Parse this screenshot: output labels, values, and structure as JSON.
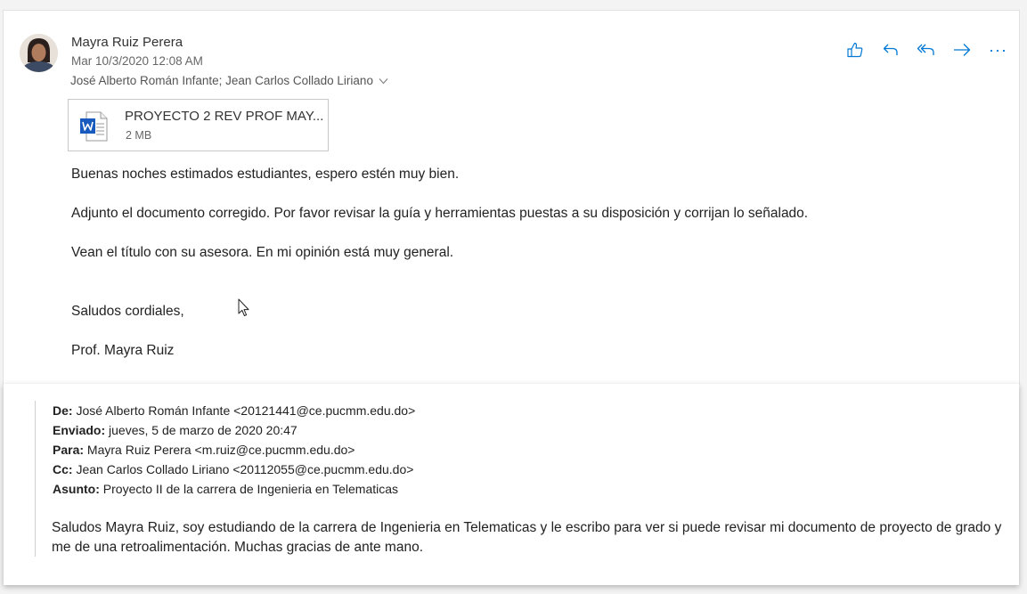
{
  "message": {
    "sender": "Mayra Ruiz Perera",
    "date": "Mar 10/3/2020 12:08 AM",
    "recipients": "José Alberto Román Infante; Jean Carlos Collado Liriano",
    "icons": {
      "avatar": "sender-avatar",
      "expand": "chevron-down-icon",
      "like": "like-icon",
      "reply": "reply-icon",
      "reply_all": "reply-all-icon",
      "forward": "forward-icon",
      "more": "more-icon"
    },
    "accent_color": "#0078d4",
    "attachment": {
      "name": "PROYECTO 2 REV PROF MAY...",
      "size": "2 MB",
      "icon": "word-doc-icon"
    },
    "body": {
      "line1": "Buenas noches estimados estudiantes, espero estén muy bien.",
      "line2": "Adjunto el documento corregido. Por favor revisar la guía y herramientas puestas a su disposición y corrijan lo señalado.",
      "line3": "Vean el título con su asesora. En mi opinión está muy general.",
      "closing": "Saludos cordiales,",
      "signature": "Prof. Mayra Ruiz"
    }
  },
  "quoted": {
    "from_label": "De:",
    "from": "José Alberto Román Infante <20121441@ce.pucmm.edu.do>",
    "sent_label": "Enviado:",
    "sent": "jueves, 5 de marzo de 2020 20:47",
    "to_label": "Para:",
    "to": "Mayra Ruiz Perera <m.ruiz@ce.pucmm.edu.do>",
    "cc_label": "Cc:",
    "cc": "Jean Carlos Collado Liriano <20112055@ce.pucmm.edu.do>",
    "subject_label": "Asunto:",
    "subject": "Proyecto II de la carrera de Ingenieria en Telematicas",
    "message": "Saludos Mayra Ruiz, soy estudiando de la carrera de Ingenieria en Telematicas y le escribo para ver si puede revisar mi documento de proyecto de grado y me de una retroalimentación. Muchas gracias de ante mano."
  }
}
